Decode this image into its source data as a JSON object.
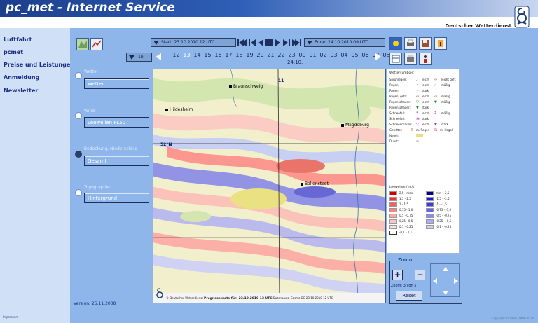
{
  "app": {
    "title": "pc_met - Internet Service",
    "provider": "Deutscher Wetterdienst"
  },
  "sidebar": {
    "items": [
      {
        "label": "Luftfahrt"
      },
      {
        "label": "pcmet"
      },
      {
        "label": "Preise und Leistungen"
      },
      {
        "label": "Anmeldung"
      },
      {
        "label": "Newsletter"
      }
    ],
    "footer": "Impressum"
  },
  "timebar": {
    "start_label": "Start: 23.10.2010 12 UTC",
    "end_label": "Ende: 24.10.2010 09 UTC",
    "step_label": "1h",
    "hours": [
      "12",
      "13",
      "14",
      "15",
      "16",
      "17",
      "18",
      "19",
      "20",
      "21",
      "22",
      "23",
      "00",
      "01",
      "02",
      "03",
      "04",
      "05",
      "06",
      "07",
      "08"
    ],
    "selected_hour": "13",
    "date_marker": "24.10."
  },
  "controls": {
    "wetter": {
      "label": "Wetter",
      "value": "Wetter"
    },
    "wind": {
      "label": "Wind",
      "value": "Leewellen FL50"
    },
    "bedeckung": {
      "label": "Bedeckung, Niederschlag",
      "value": "Gesamt"
    },
    "topographie": {
      "label": "Topographie",
      "value": "Hintergrund"
    }
  },
  "version": "Version: 25.11.2008",
  "map": {
    "cities": [
      {
        "name": "Braunschweig"
      },
      {
        "name": "Hildesheim"
      },
      {
        "name": "Magdeburg"
      },
      {
        "name": "Ballenstedt"
      }
    ],
    "lat_label": "52°N",
    "grid_label": "11",
    "footer_prefix": "© Deutscher Wetterdienst",
    "footer_title": "Prognosekarte für: 23.10.2010 13 UTC",
    "footer_suffix": "Datenbasis: Cosmo-DE 23.10.2010 12 UTC"
  },
  "legend": {
    "title": "Wettersymbole:",
    "symbols": [
      {
        "name": "Sprühregen:",
        "a": "leicht",
        "b": "leicht gefr."
      },
      {
        "name": "Regen:",
        "a": "leicht",
        "b": "mäßig"
      },
      {
        "name": "Regen:",
        "a": "stark",
        "b": ""
      },
      {
        "name": "Regen, gefr.:",
        "a": "leicht",
        "b": "mäßig"
      },
      {
        "name": "Regenschauer:",
        "a": "leicht",
        "b": "mäßig"
      },
      {
        "name": "Regenschauer:",
        "a": "stark",
        "b": ""
      },
      {
        "name": "Schneefall:",
        "a": "leicht",
        "b": "mäßig"
      },
      {
        "name": "Schneefall:",
        "a": "stark",
        "b": ""
      },
      {
        "name": "Schneeschauer:",
        "a": "leicht",
        "b": "stark"
      },
      {
        "name": "Gewitter:",
        "a": "m. Regen",
        "b": "m. Hagel"
      },
      {
        "name": "Nebel:",
        "a": "",
        "b": ""
      },
      {
        "name": "Dunst:",
        "a": "",
        "b": ""
      }
    ],
    "leewellen_title": "Leewellen (m /s)",
    "leewellen": [
      {
        "pos": "2,5 - max",
        "pos_color": "#d40000",
        "neg": "min - -2,5",
        "neg_color": "#00008c"
      },
      {
        "pos": "1,5 - 2,5",
        "pos_color": "#ff2b2b",
        "neg": "-1,5 - -2,5",
        "neg_color": "#1a1ad0"
      },
      {
        "pos": "1 - 1,5",
        "pos_color": "#ff5c5c",
        "neg": "-1 - -1,5",
        "neg_color": "#3b3bf0"
      },
      {
        "pos": "0,75 - 1,0",
        "pos_color": "#ff8585",
        "neg": "-0,75 - -1,0",
        "neg_color": "#6262f5"
      },
      {
        "pos": "0,5 - 0,75",
        "pos_color": "#ffa8a8",
        "neg": "-0,5 - -0,75",
        "neg_color": "#8a8af8"
      },
      {
        "pos": "0,25 - 0,5",
        "pos_color": "#ffc6c6",
        "neg": "-0,25 - -0,5",
        "neg_color": "#ababfa"
      },
      {
        "pos": "0,1 - 0,25",
        "pos_color": "#ffdede",
        "neg": "-0,1 - -0,25",
        "neg_color": "#cfcffc"
      },
      {
        "pos": "-0,1 - 0,1",
        "pos_color": "#ffffff",
        "neg": "",
        "neg_color": ""
      }
    ]
  },
  "zoom": {
    "title": "Zoom",
    "plus": "+",
    "minus": "−",
    "status": "Zoom: 3 von 5",
    "reset": "Reset"
  },
  "copyright": "Copyright © DWD, 1999-2010"
}
